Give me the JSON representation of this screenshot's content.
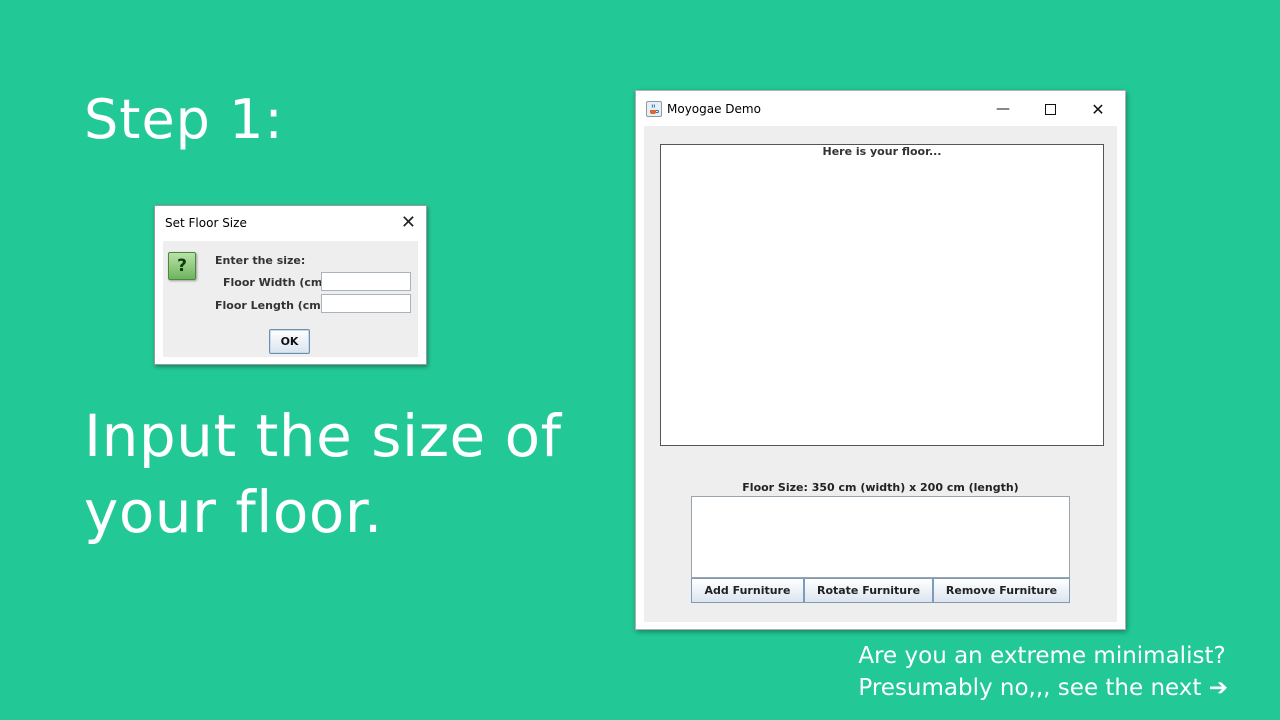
{
  "slide": {
    "step_title": "Step 1:",
    "instruction_line1": "Input the size of",
    "instruction_line2": "your floor.",
    "footer_line1": "Are you an extreme minimalist?",
    "footer_line2": "Presumably no,,, see the next ➔",
    "background_color": "#22c997"
  },
  "dialog": {
    "title": "Set Floor Size",
    "close_icon": "close-icon",
    "icon": "question-icon",
    "icon_glyph": "?",
    "prompt": "Enter the size:",
    "width_label": "Floor Width (cm)",
    "width_value": "",
    "length_label": "Floor Length (cm)",
    "length_value": "",
    "ok_label": "OK"
  },
  "app": {
    "title": "Moyogae Demo",
    "minimize_glyph": "—",
    "maximize_glyph": "☐",
    "close_glyph": "✕",
    "floor_caption": "Here is your floor...",
    "floor_size_text": "Floor Size: 350 cm (width) x 200 cm (length)",
    "buttons": {
      "add": "Add Furniture",
      "rotate": "Rotate Furniture",
      "remove": "Remove Furniture"
    }
  }
}
